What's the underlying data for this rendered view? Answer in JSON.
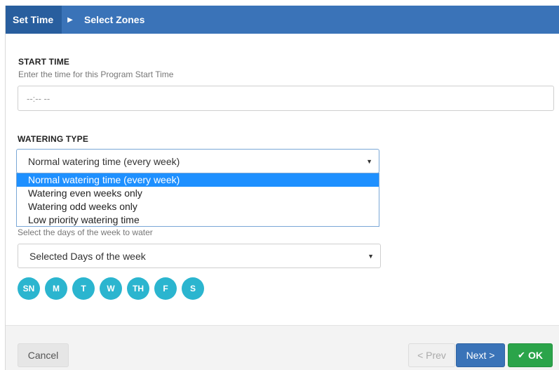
{
  "breadcrumb": {
    "active": "Set Time",
    "separator_icon": "caret-right-icon",
    "next": "Select Zones"
  },
  "start_time": {
    "label": "START TIME",
    "help": "Enter the time for this Program Start Time",
    "value": "--:-- --"
  },
  "watering_type": {
    "label": "WATERING TYPE",
    "selected": "Normal watering time (every week)",
    "options": [
      "Normal watering time (every week)",
      "Watering even weeks only",
      "Watering odd weeks only",
      "Low priority watering time"
    ]
  },
  "days": {
    "help": "Select the days of the week to water",
    "selected": "Selected Days of the week",
    "items": [
      "SN",
      "M",
      "T",
      "W",
      "TH",
      "F",
      "S"
    ]
  },
  "footer": {
    "cancel": "Cancel",
    "prev": "< Prev",
    "next": "Next >",
    "ok": "OK",
    "ok_icon": "checkmark-icon"
  },
  "colors": {
    "header": "#3a73b8",
    "header_active": "#285e9e",
    "day_badge": "#2bb5cf",
    "ok_button": "#2ba44a",
    "option_highlight": "#1e90ff"
  }
}
